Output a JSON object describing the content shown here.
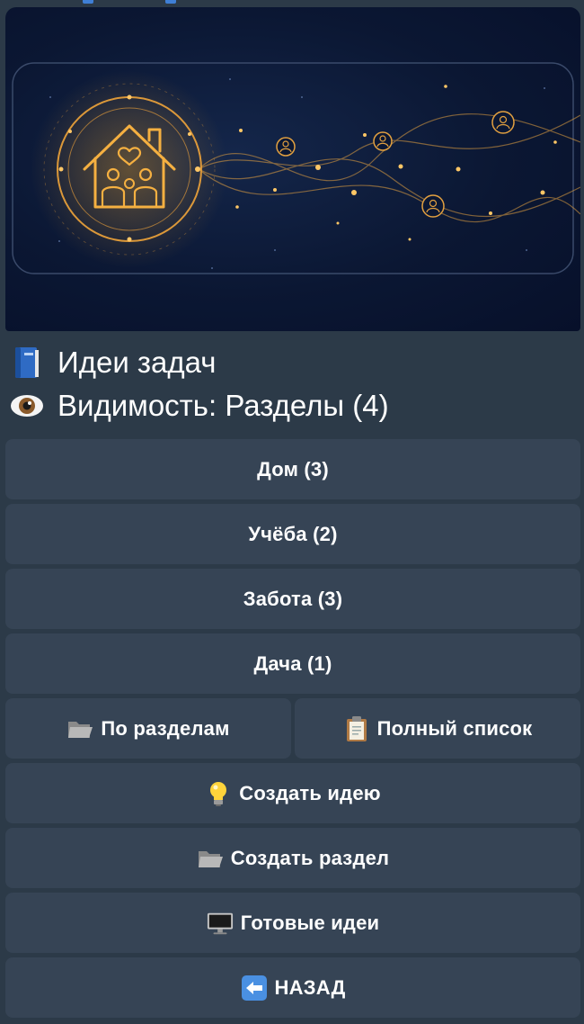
{
  "header": {
    "title_line": "Идеи задач",
    "visibility_line": "Видимость: Разделы (4)"
  },
  "icons": {
    "title": "blue-book-icon",
    "visibility": "eye-icon",
    "by_sections": "open-folder-icon",
    "full_list": "clipboard-icon",
    "create_idea": "light-bulb-icon",
    "create_section": "open-folder-icon",
    "ready_ideas": "desktop-computer-icon",
    "back": "left-arrow-icon"
  },
  "sections": [
    {
      "label": "Дом (3)"
    },
    {
      "label": "Учёба (2)"
    },
    {
      "label": "Забота (3)"
    },
    {
      "label": "Дача (1)"
    }
  ],
  "actions": {
    "by_sections": "По разделам",
    "full_list": "Полный список",
    "create_idea": "Создать идею",
    "create_section": "Создать раздел",
    "ready_ideas": "Готовые идеи",
    "back": "НАЗАД"
  },
  "colors": {
    "background": "#2c3a48",
    "button": "#364455",
    "banner_glow": "#f5a623"
  }
}
